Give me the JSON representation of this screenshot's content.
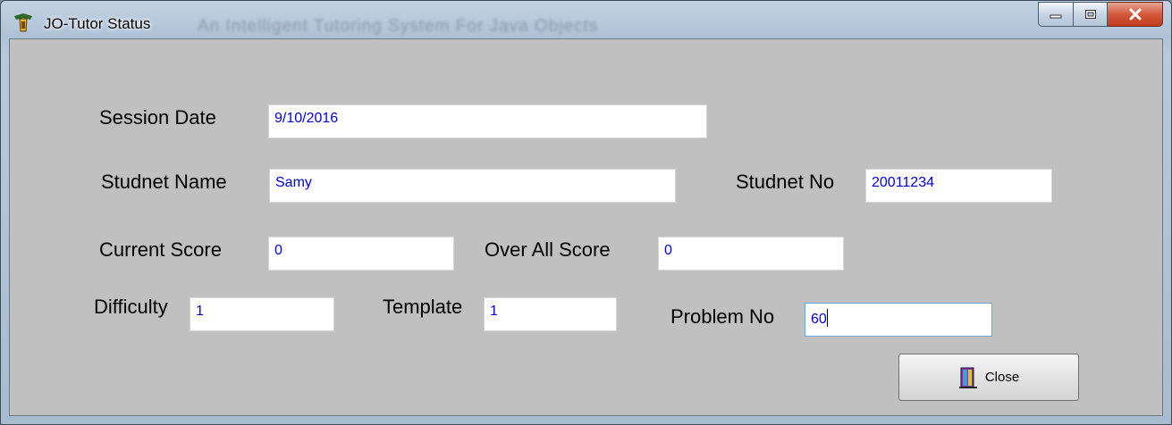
{
  "window": {
    "title": "JO-Tutor Status",
    "background_title": "An Intelligent Tutoring System For Java Objects"
  },
  "form": {
    "session_date": {
      "label": "Session Date",
      "value": "9/10/2016"
    },
    "student_name": {
      "label": "Studnet Name",
      "value": "Samy"
    },
    "student_no": {
      "label": "Studnet No",
      "value": "20011234"
    },
    "current_score": {
      "label": "Current Score",
      "value": "0"
    },
    "overall_score": {
      "label": "Over All Score",
      "value": "0"
    },
    "difficulty": {
      "label": "Difficulty",
      "value": "1"
    },
    "template": {
      "label": "Template",
      "value": "1"
    },
    "problem_no": {
      "label": "Problem No",
      "value": "60"
    }
  },
  "buttons": {
    "close_label": "Close"
  },
  "colors": {
    "field_text": "#0000ee",
    "client_bg": "#c0c0c0",
    "close_caption": "#c3391c"
  },
  "icons": {
    "app": "jo-tutor-app-icon",
    "close_button": "exit-door-icon"
  }
}
